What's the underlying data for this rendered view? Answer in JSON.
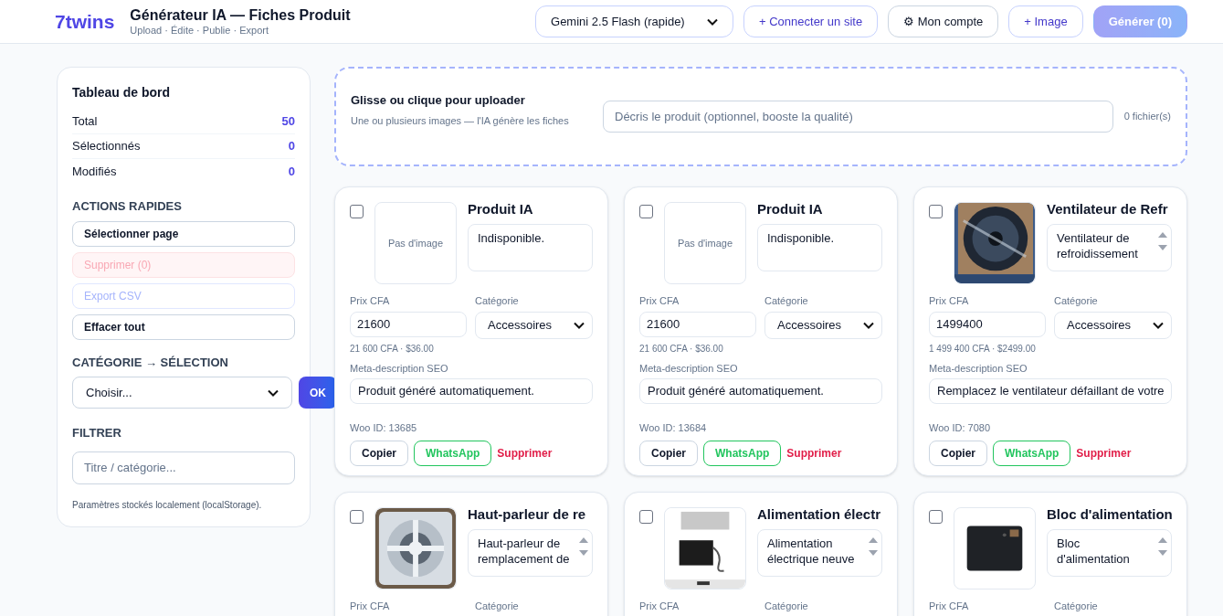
{
  "header": {
    "logo": "7twins",
    "title": "Générateur IA — Fiches Produit",
    "subtitle": "Upload · Édite · Publie · Export",
    "model_select": "Gemini 2.5 Flash (rapide)",
    "buttons": [
      {
        "label": "+ Connecter un site",
        "kind": "outline",
        "disabled": false
      },
      {
        "label": "⚙ Mon compte",
        "kind": "neutral",
        "disabled": false
      },
      {
        "label": "+ Image",
        "kind": "outline",
        "disabled": false
      },
      {
        "label": "Générer (0)",
        "kind": "primary",
        "disabled": true
      }
    ]
  },
  "sidebar": {
    "title": "Tableau de bord",
    "stats": [
      {
        "label": "Total",
        "value": "50"
      },
      {
        "label": "Sélectionnés",
        "value": "0"
      },
      {
        "label": "Modifiés",
        "value": "0"
      }
    ],
    "actions_heading": "ACTIONS RAPIDES",
    "actions": [
      {
        "label": "Sélectionner page",
        "kind": "neutral",
        "disabled": false
      },
      {
        "label": "Supprimer (0)",
        "kind": "danger",
        "disabled": true
      },
      {
        "label": "Export CSV",
        "kind": "primary",
        "disabled": true
      },
      {
        "label": "Effacer tout",
        "kind": "neutral",
        "disabled": false
      }
    ],
    "category_heading": "CATÉGORIE → SÉLECTION",
    "category_select": "Choisir...",
    "ok_button": "OK",
    "filter_heading": "FILTRER",
    "filter_placeholder": "Titre / catégorie...",
    "footnote": "Paramètres stockés localement (localStorage)."
  },
  "upload": {
    "title": "Glisse ou clique pour uploader",
    "hint": "Une ou plusieurs images — l'IA génère les fiches",
    "description_placeholder": "Décris le produit (optionnel, booste la qualité)",
    "file_count": "0 fichier(s)"
  },
  "products": [
    {
      "checked": false,
      "image": {
        "kind": "empty",
        "label": "Pas d'image"
      },
      "title": "Produit IA",
      "description": "Indisponible.",
      "scroll": false,
      "price_label": "Prix CFA",
      "category_label": "Catégorie",
      "price": "21600",
      "category": "Accessoires",
      "price_note": "21 600 CFA · $36.00",
      "meta_label": "Meta-description SEO",
      "meta": "Produit généré automatiquement.",
      "woo_id": "Woo ID: 13685",
      "actions": [
        "Copier",
        "WhatsApp",
        "Supprimer"
      ]
    },
    {
      "checked": false,
      "image": {
        "kind": "empty",
        "label": "Pas d'image"
      },
      "title": "Produit IA",
      "description": "Indisponible.",
      "scroll": false,
      "price_label": "Prix CFA",
      "category_label": "Catégorie",
      "price": "21600",
      "category": "Accessoires",
      "price_note": "21 600 CFA · $36.00",
      "meta_label": "Meta-description SEO",
      "meta": "Produit généré automatiquement.",
      "woo_id": "Woo ID: 13684",
      "actions": [
        "Copier",
        "WhatsApp",
        "Supprimer"
      ]
    },
    {
      "checked": false,
      "image": {
        "kind": "picture"
      },
      "title": "Ventilateur de Refr",
      "description": "Ventilateur de refroidissement",
      "scroll": true,
      "price_label": "Prix CFA",
      "category_label": "Catégorie",
      "price": "1499400",
      "category": "Accessoires",
      "price_note": "1 499 400 CFA · $2499.00",
      "meta_label": "Meta-description SEO",
      "meta": "Remplacez le ventilateur défaillant de votre",
      "woo_id": "Woo ID: 7080",
      "actions": [
        "Copier",
        "WhatsApp",
        "Supprimer"
      ]
    },
    {
      "checked": false,
      "image": {
        "kind": "picture"
      },
      "title": "Haut-parleur de re",
      "description": "Haut-parleur de remplacement de",
      "scroll": true,
      "price_label": "Prix CFA",
      "category_label": "Catégorie"
    },
    {
      "checked": false,
      "image": {
        "kind": "picture"
      },
      "title": "Alimentation électr",
      "description": "Alimentation électrique neuve",
      "scroll": true,
      "price_label": "Prix CFA",
      "category_label": "Catégorie"
    },
    {
      "checked": false,
      "image": {
        "kind": "picture"
      },
      "title": "Bloc d'alimentation",
      "description": "Bloc d'alimentation",
      "scroll": true,
      "price_label": "Prix CFA",
      "category_label": "Catégorie"
    }
  ]
}
